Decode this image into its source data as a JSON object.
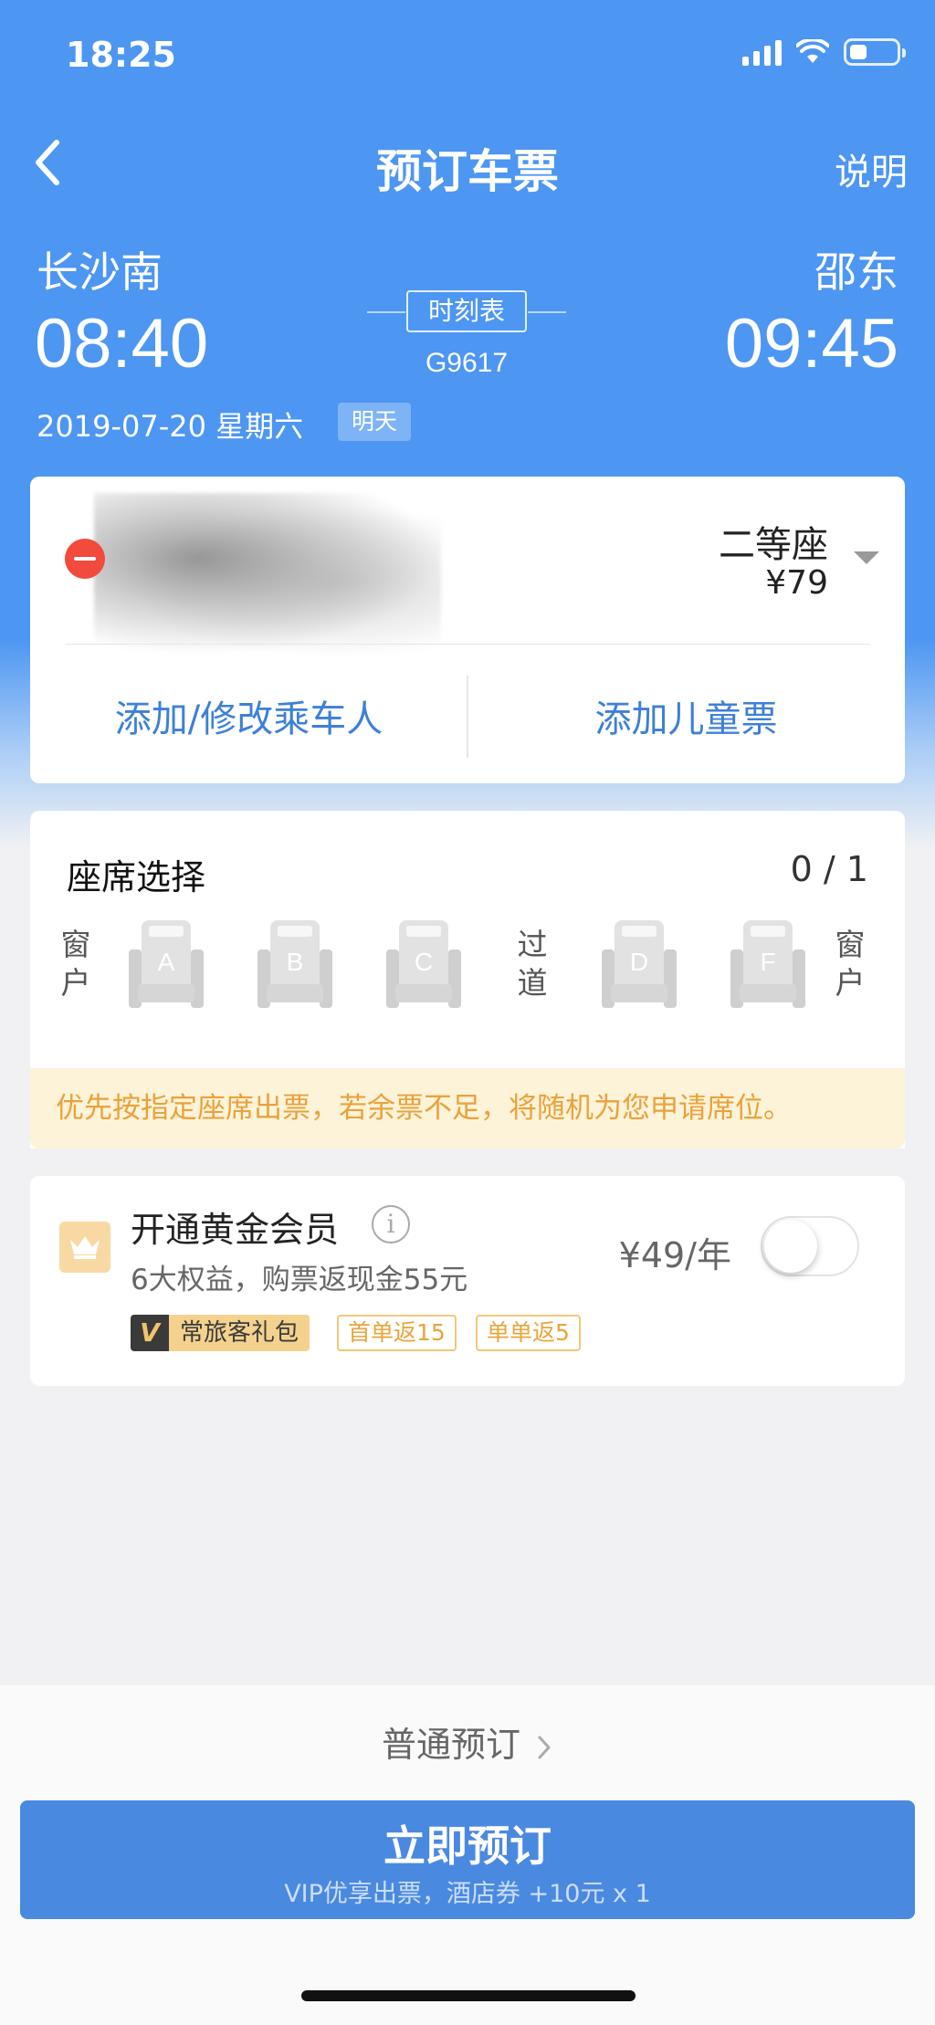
{
  "status_bar": {
    "time": "18:25"
  },
  "nav": {
    "title": "预订车票",
    "help_label": "说明"
  },
  "trip": {
    "from_station": "长沙南",
    "to_station": "邵东",
    "departure_time": "08:40",
    "arrival_time": "09:45",
    "timetable_label": "时刻表",
    "train_number": "G9617",
    "date": "2019-07-20 星期六",
    "day_badge": "明天"
  },
  "passenger": {
    "seat_class": "二等座",
    "price": "¥79",
    "add_passenger_label": "添加/修改乘车人",
    "add_child_label": "添加儿童票"
  },
  "seat_selection": {
    "title": "座席选择",
    "count": "0 / 1",
    "window_label": "窗户",
    "aisle_label": "过道",
    "seats": [
      "A",
      "B",
      "C",
      "D",
      "F"
    ],
    "notice": "优先按指定座席出票，若余票不足，将随机为您申请席位。"
  },
  "vip": {
    "title": "开通黄金会员",
    "subtitle": "6大权益，购票返现金55元",
    "price": "¥49/年",
    "toggle_on": false,
    "gift_badge_letter": "V",
    "gift_badge_text": "常旅客礼包",
    "tag_first": "首单返15",
    "tag_each": "单单返5"
  },
  "bottom": {
    "normal_book_label": "普通预订",
    "book_now_label": "立即预订",
    "book_now_sub": "VIP优享出票，酒店券 +10元 x 1"
  },
  "colors": {
    "primary_blue": "#4d96f2",
    "button_blue": "#4a89e0",
    "link_blue": "#3d80d6",
    "notice_text": "#e9a23b"
  }
}
